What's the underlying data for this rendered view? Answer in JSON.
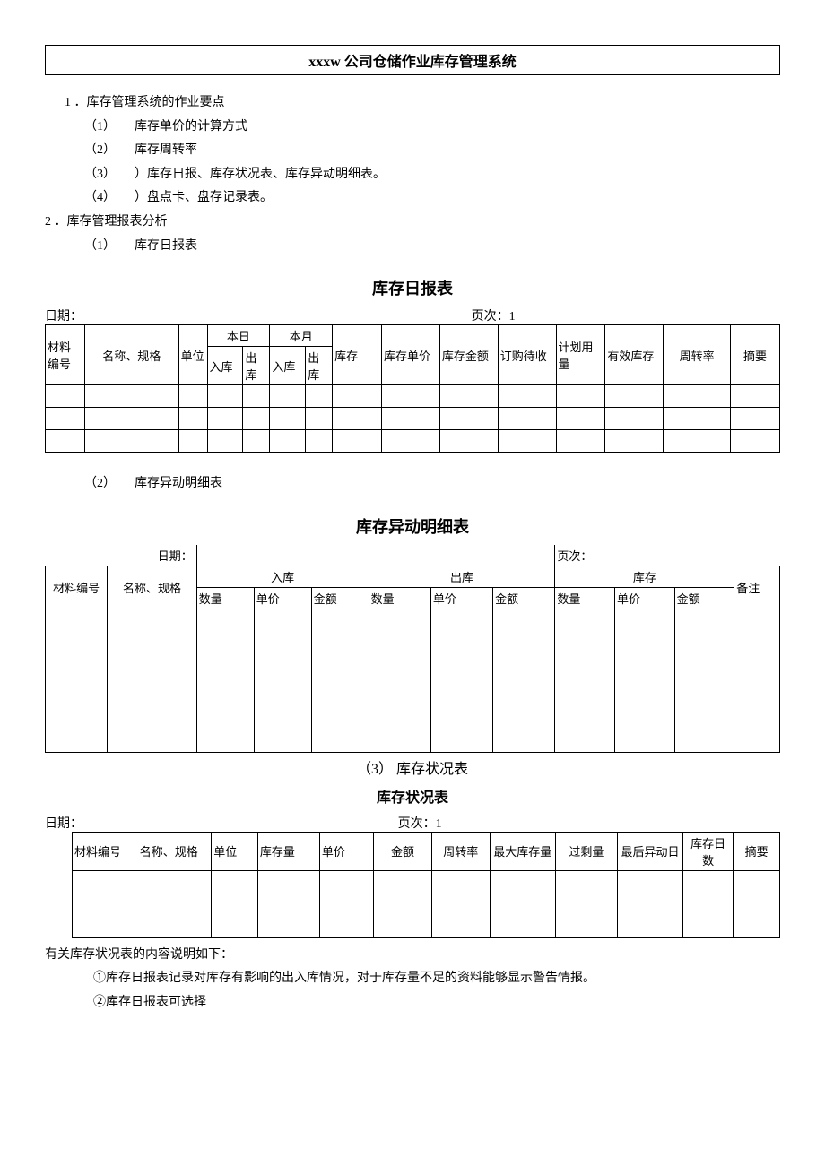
{
  "doc_title": "xxxw 公司仓储作业库存管理系统",
  "s1": {
    "heading": "1 ．库存管理系统的作业要点",
    "items": [
      {
        "num": "（1）",
        "text": "库存单价的计算方式"
      },
      {
        "num": "（2）",
        "text": "库存周转率"
      },
      {
        "num": "（3）",
        "text": "）库存日报、库存状况表、库存异动明细表。"
      },
      {
        "num": "（4）",
        "text": "）盘点卡、盘存记录表。"
      }
    ]
  },
  "s2": {
    "heading": "2 ．库存管理报表分析",
    "sub1": {
      "num": "（1）",
      "text": "库存日报表"
    }
  },
  "table1": {
    "title": "库存日报表",
    "meta_date_label": "日期：",
    "meta_page_label": "页次：",
    "meta_page_value": "1",
    "headers": {
      "col1": "材料编号",
      "col2": "名称、规格",
      "col3": "单位",
      "group_today": "本日",
      "group_month": "本月",
      "in": "入库",
      "out": "出库",
      "col8": "库存",
      "col9": "库存单价",
      "col10": "库存金额",
      "col11": "订购待收",
      "col12": "计划用量",
      "col13": "有效库存",
      "col14": "周转率",
      "col15": "摘要"
    }
  },
  "subsection2_2": {
    "num": "（2）",
    "text": "库存异动明细表"
  },
  "table2": {
    "title": "库存异动明细表",
    "meta_date_label": "日期：",
    "meta_page_label": "页次：",
    "headers": {
      "col1": "材料编号",
      "col2": "名称、规格",
      "group_in": "入库",
      "group_out": "出库",
      "group_stock": "库存",
      "qty": "数量",
      "price": "单价",
      "amount": "金额",
      "remark": "备注"
    }
  },
  "subsection2_3": "（3） 库存状况表",
  "table3": {
    "title": "库存状况表",
    "meta_date_label": "日期：",
    "meta_page_label": "页次：",
    "meta_page_value": "1",
    "headers": {
      "col1": "材料编号",
      "col2": "名称、规格",
      "col3": "单位",
      "col4": "库存量",
      "col5": "单价",
      "col6": "金额",
      "col7": "周转率",
      "col8": "最大库存量",
      "col9": "过剩量",
      "col10": "最后异动日",
      "col11": "库存日数",
      "col12": "摘要"
    }
  },
  "notes": {
    "intro": "有关库存状况表的内容说明如下：",
    "n1": "①库存日报表记录对库存有影响的出入库情况，对于库存量不足的资料能够显示警告情报。",
    "n2": "②库存日报表可选择"
  }
}
